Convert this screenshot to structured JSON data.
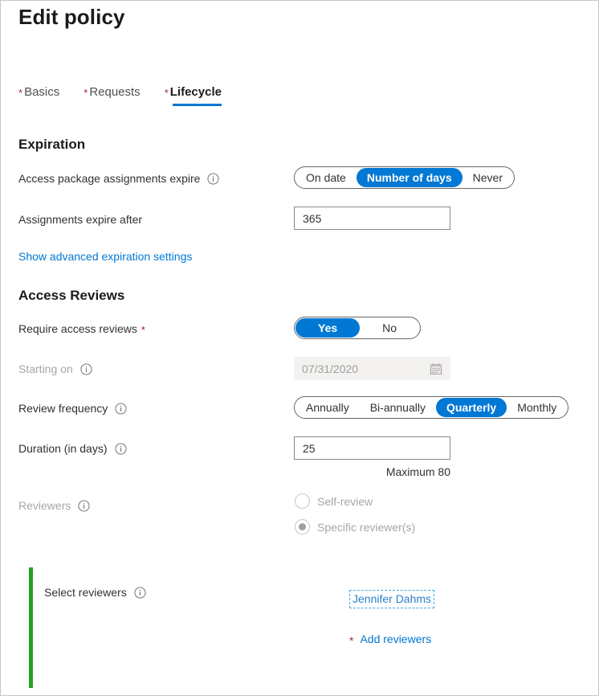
{
  "page": {
    "title": "Edit policy"
  },
  "tabs": [
    {
      "label": "Basics",
      "required": true,
      "active": false
    },
    {
      "label": "Requests",
      "required": true,
      "active": false
    },
    {
      "label": "Lifecycle",
      "required": true,
      "active": true
    }
  ],
  "expiration": {
    "heading": "Expiration",
    "assignments_expire": {
      "label": "Access package assignments expire",
      "info_icon": "info-icon",
      "options": [
        "On date",
        "Number of days",
        "Never"
      ],
      "selected": "Number of days"
    },
    "expire_after": {
      "label": "Assignments expire after",
      "value": "365"
    },
    "advanced_link": "Show advanced expiration settings"
  },
  "access_reviews": {
    "heading": "Access Reviews",
    "require": {
      "label": "Require access reviews",
      "required": true,
      "options": [
        "Yes",
        "No"
      ],
      "selected": "Yes"
    },
    "starting_on": {
      "label": "Starting on",
      "info_icon": "info-icon",
      "value": "07/31/2020",
      "disabled": true,
      "calendar_icon": "calendar-icon"
    },
    "frequency": {
      "label": "Review frequency",
      "info_icon": "info-icon",
      "options": [
        "Annually",
        "Bi-annually",
        "Quarterly",
        "Monthly"
      ],
      "selected": "Quarterly"
    },
    "duration": {
      "label": "Duration (in days)",
      "info_icon": "info-icon",
      "value": "25",
      "helper": "Maximum 80"
    },
    "reviewers": {
      "label": "Reviewers",
      "info_icon": "info-icon",
      "disabled": true,
      "options": [
        {
          "label": "Self-review",
          "checked": false
        },
        {
          "label": "Specific reviewer(s)",
          "checked": true
        }
      ]
    }
  },
  "select_reviewers": {
    "label": "Select reviewers",
    "info_icon": "info-icon",
    "selected_reviewer": "Jennifer Dahms",
    "add_link": "Add reviewers",
    "add_required": true
  },
  "colors": {
    "accent": "#0078d4",
    "required_star": "#a4262c",
    "link": "#0078d4",
    "annotation_bar": "#24a124",
    "reviewer_outline": "#4aa8e0",
    "disabled_text": "#a6a6a6"
  }
}
